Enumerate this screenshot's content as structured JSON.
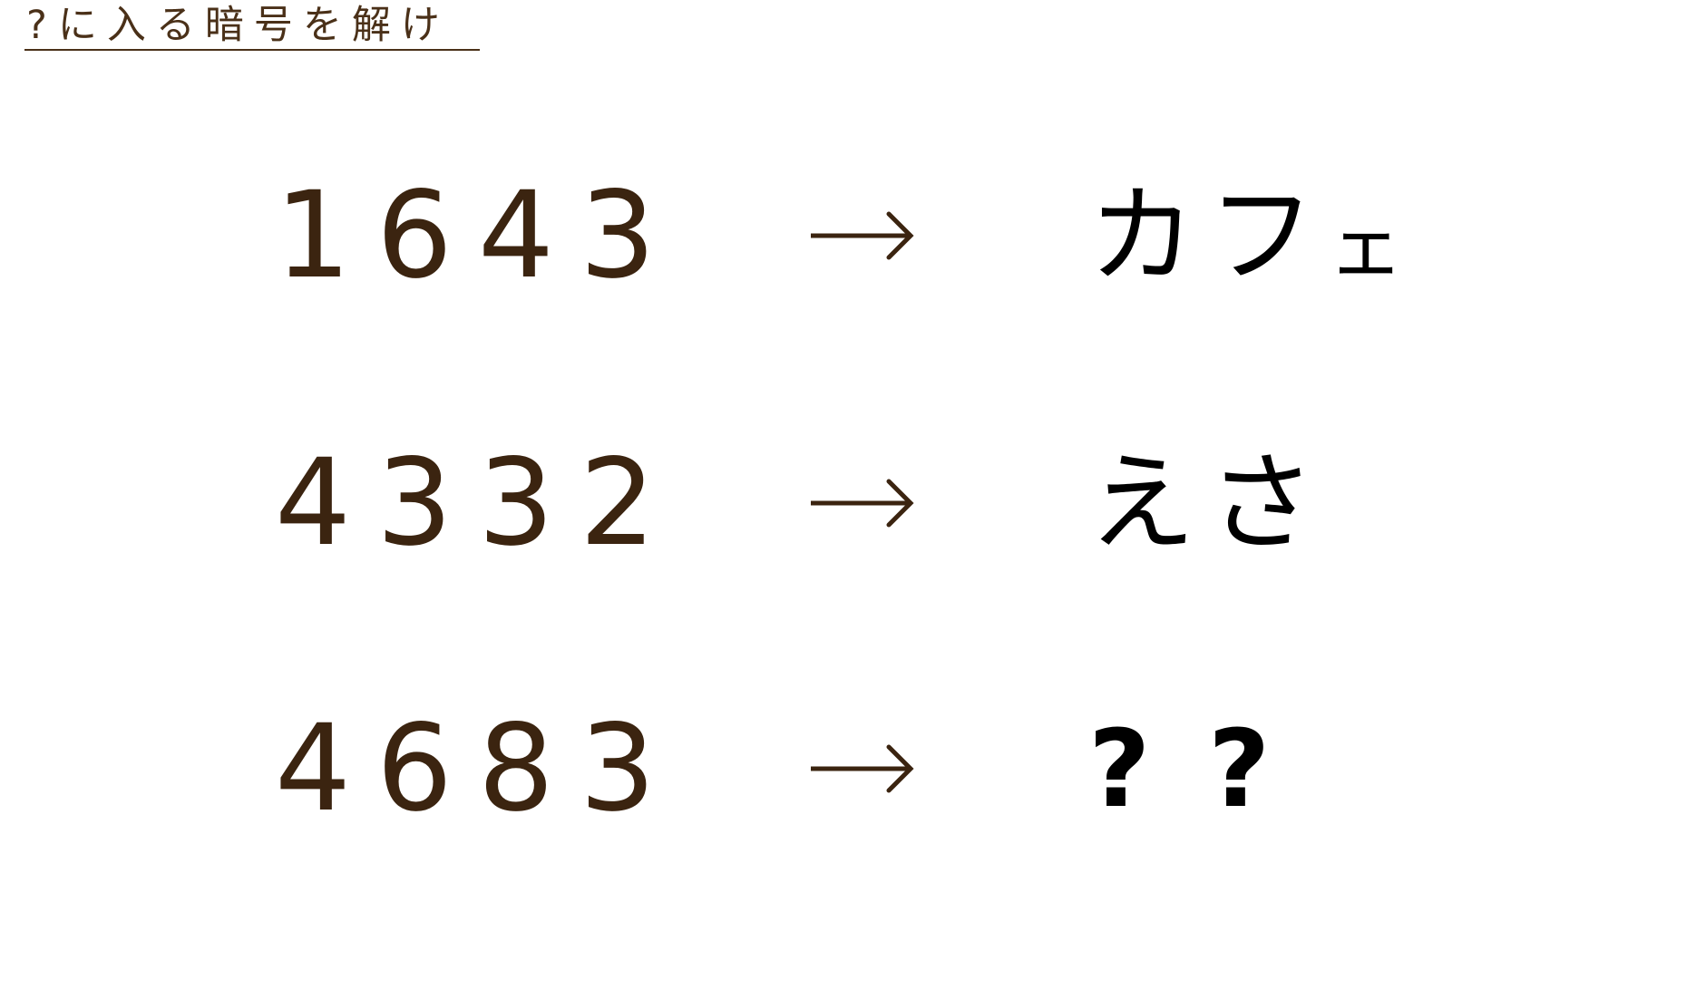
{
  "title": "?に入る暗号を解け",
  "rows": [
    {
      "code": "1643",
      "arrow": "→",
      "answer_chars": [
        "カ",
        "フ",
        "ェ"
      ]
    },
    {
      "code": "4332",
      "arrow": "→",
      "answer_chars": [
        "え",
        "さ"
      ]
    },
    {
      "code": "4683",
      "arrow": "→",
      "answer_chars": [
        "?",
        "?"
      ]
    }
  ],
  "colors": {
    "code": "#3b2410",
    "arrow": "#3b2410",
    "answer": "#000000",
    "title": "#4a3018"
  }
}
